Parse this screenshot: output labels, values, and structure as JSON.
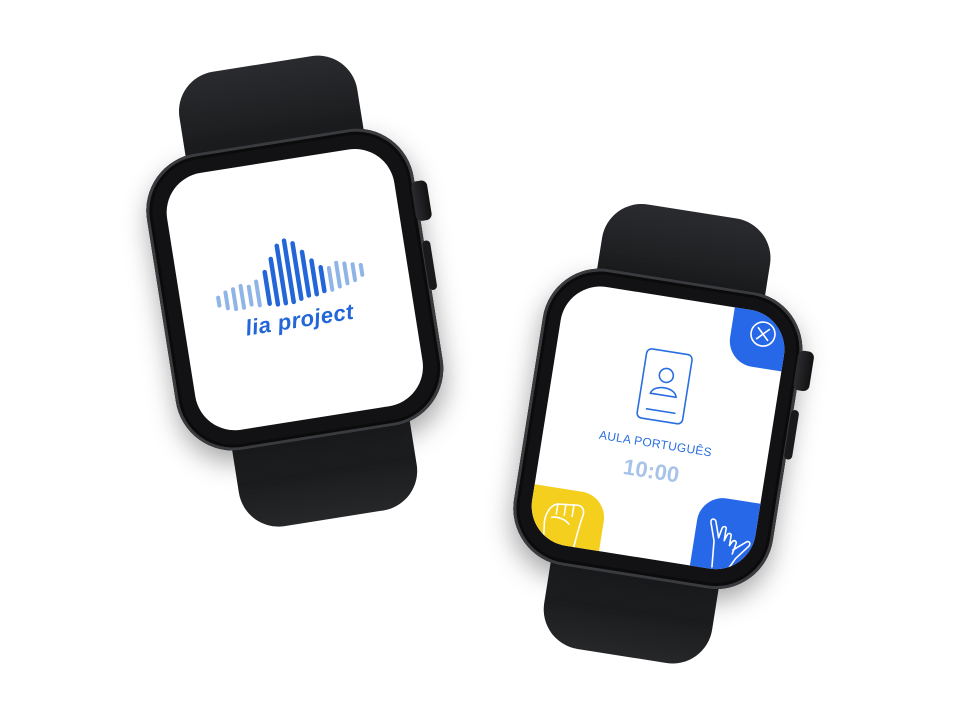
{
  "watch_left": {
    "logo_text": "lia project"
  },
  "watch_right": {
    "class_label": "AULA PORTUGUÊS",
    "class_time": "10:00",
    "icons": {
      "close": "close-icon",
      "profile": "profile-card-icon",
      "hand": "hand-sign-icon",
      "fist": "fist-icon"
    }
  },
  "colors": {
    "brand_blue": "#2768e8",
    "accent_yellow": "#f5cf1d",
    "time_light_blue": "#a8c3e8"
  }
}
